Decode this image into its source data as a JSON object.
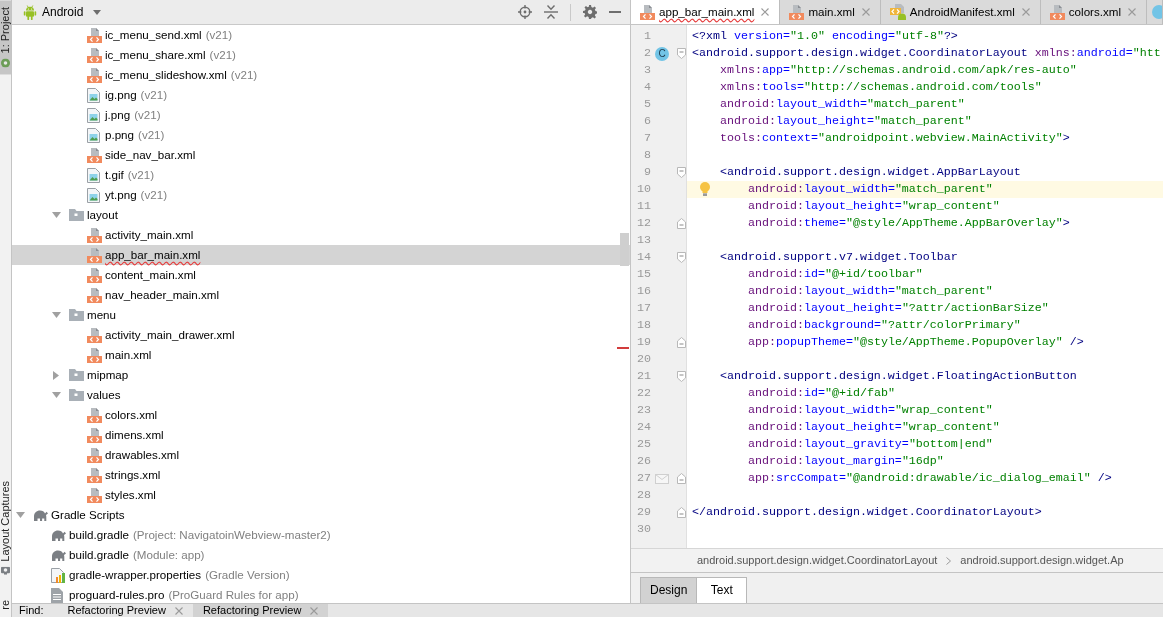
{
  "left_tabs": {
    "top": [
      {
        "label": "1: Project",
        "selected": true
      }
    ],
    "bottom": [
      {
        "label": "Layout Captures",
        "selected": false
      },
      {
        "label": "re",
        "selected": false
      }
    ]
  },
  "project": {
    "view": "Android",
    "tree": [
      {
        "children": [
          {
            "children": [
              {
                "children": [
                  {
                    "label": "ic_menu_send.xml",
                    "qualifier": "(v21)",
                    "kind": "xml",
                    "selected": false,
                    "error": false
                  },
                  {
                    "label": "ic_menu_share.xml",
                    "qualifier": "(v21)",
                    "kind": "xml",
                    "selected": false,
                    "error": false
                  },
                  {
                    "label": "ic_menu_slideshow.xml",
                    "qualifier": "(v21)",
                    "kind": "xml",
                    "selected": false,
                    "error": false
                  },
                  {
                    "label": "ig.png",
                    "qualifier": "(v21)",
                    "kind": "image",
                    "selected": false,
                    "error": false
                  },
                  {
                    "label": "j.png",
                    "qualifier": "(v21)",
                    "kind": "image",
                    "selected": false,
                    "error": false
                  },
                  {
                    "label": "p.png",
                    "qualifier": "(v21)",
                    "kind": "image",
                    "selected": false,
                    "error": false
                  },
                  {
                    "label": "side_nav_bar.xml",
                    "kind": "xml",
                    "selected": false,
                    "error": false
                  },
                  {
                    "label": "t.gif",
                    "qualifier": "(v21)",
                    "kind": "image",
                    "selected": false,
                    "error": false
                  },
                  {
                    "label": "yt.png",
                    "qualifier": "(v21)",
                    "kind": "image",
                    "selected": false,
                    "error": false
                  }
                ]
              },
              {
                "label": "layout",
                "kind": "folder",
                "expanded": true,
                "selected": false,
                "error": false,
                "children": [
                  {
                    "label": "activity_main.xml",
                    "kind": "xml",
                    "selected": false,
                    "error": false
                  },
                  {
                    "label": "app_bar_main.xml",
                    "kind": "xml",
                    "selected": true,
                    "error": true
                  },
                  {
                    "label": "content_main.xml",
                    "kind": "xml",
                    "selected": false,
                    "error": false
                  },
                  {
                    "label": "nav_header_main.xml",
                    "kind": "xml",
                    "selected": false,
                    "error": false
                  }
                ]
              },
              {
                "label": "menu",
                "kind": "folder",
                "expanded": true,
                "selected": false,
                "error": false,
                "children": [
                  {
                    "label": "activity_main_drawer.xml",
                    "kind": "xml",
                    "selected": false,
                    "error": false
                  },
                  {
                    "label": "main.xml",
                    "kind": "xml",
                    "selected": false,
                    "error": false
                  }
                ]
              },
              {
                "label": "mipmap",
                "kind": "folder",
                "expanded": false,
                "selected": false,
                "error": false
              },
              {
                "label": "values",
                "kind": "folder",
                "expanded": true,
                "selected": false,
                "error": false,
                "children": [
                  {
                    "label": "colors.xml",
                    "kind": "xml",
                    "selected": false,
                    "error": false
                  },
                  {
                    "label": "dimens.xml",
                    "kind": "xml",
                    "selected": false,
                    "error": false
                  },
                  {
                    "label": "drawables.xml",
                    "kind": "xml",
                    "selected": false,
                    "error": false
                  },
                  {
                    "label": "strings.xml",
                    "kind": "xml",
                    "selected": false,
                    "error": false
                  },
                  {
                    "label": "styles.xml",
                    "kind": "xml",
                    "selected": false,
                    "error": false
                  }
                ]
              }
            ]
          }
        ]
      },
      {
        "label": "Gradle Scripts",
        "kind": "gradle",
        "expanded": true,
        "selected": false,
        "error": false,
        "children": [
          {
            "label": "build.gradle",
            "qualifier": "(Project: NavigatoinWebview-master2)",
            "kind": "gradle",
            "selected": false,
            "error": false
          },
          {
            "label": "build.gradle",
            "qualifier": "(Module: app)",
            "kind": "gradle",
            "selected": false,
            "error": false
          },
          {
            "label": "gradle-wrapper.properties",
            "qualifier": "(Gradle Version)",
            "kind": "properties",
            "selected": false,
            "error": false
          },
          {
            "label": "proguard-rules.pro",
            "qualifier": "(ProGuard Rules for app)",
            "kind": "text",
            "selected": false,
            "error": false
          }
        ]
      }
    ]
  },
  "editor": {
    "tabs": [
      {
        "label": "app_bar_main.xml",
        "kind": "xml",
        "selected": true,
        "error": true
      },
      {
        "label": "main.xml",
        "kind": "xml",
        "selected": false,
        "error": false
      },
      {
        "label": "AndroidManifest.xml",
        "kind": "manifest",
        "selected": false,
        "error": false
      },
      {
        "label": "colors.xml",
        "kind": "xml",
        "selected": false,
        "error": false
      },
      {
        "kind": "class",
        "selected": false
      }
    ],
    "lines": [
      {
        "number": "1",
        "text": "<?xml version=\"1.0\" encoding=\"utf-8\"?>",
        "kind": "plain",
        "current": false
      },
      {
        "number": "2",
        "text": "<android.support.design.widget.CoordinatorLayout xmlns:android=\"htt",
        "kind": "start",
        "gutter_icon": {
          "kind": "class",
          "letter": "C"
        },
        "current": false
      },
      {
        "number": "3",
        "text": "    xmlns:app=\"http://schemas.android.com/apk/res-auto\"",
        "kind": "plain",
        "current": false
      },
      {
        "number": "4",
        "text": "    xmlns:tools=\"http://schemas.android.com/tools\"",
        "kind": "plain",
        "current": false
      },
      {
        "number": "5",
        "text": "    android:layout_width=\"match_parent\"",
        "kind": "plain",
        "current": false
      },
      {
        "number": "6",
        "text": "    android:layout_height=\"match_parent\"",
        "kind": "plain",
        "current": false
      },
      {
        "number": "7",
        "text": "    tools:context=\"androidpoint.webview.MainActivity\">",
        "kind": "plain",
        "current": false
      },
      {
        "number": "8",
        "kind": "plain",
        "current": false
      },
      {
        "number": "9",
        "text": "    <android.support.design.widget.AppBarLayout",
        "kind": "start",
        "current": false
      },
      {
        "number": "10",
        "text": "        android:layout_width=\"match_parent\"",
        "kind": "plain",
        "gutter_icon": {
          "kind": "bulb"
        },
        "current": true
      },
      {
        "number": "11",
        "text": "        android:layout_height=\"wrap_content\"",
        "kind": "plain",
        "current": false
      },
      {
        "number": "12",
        "text": "        android:theme=\"@style/AppTheme.AppBarOverlay\">",
        "kind": "end",
        "current": false
      },
      {
        "number": "13",
        "kind": "plain",
        "current": false
      },
      {
        "number": "14",
        "text": "    <android.support.v7.widget.Toolbar",
        "kind": "start",
        "current": false
      },
      {
        "number": "15",
        "text": "        android:id=\"@+id/toolbar\"",
        "kind": "plain",
        "current": false
      },
      {
        "number": "16",
        "text": "        android:layout_width=\"match_parent\"",
        "kind": "plain",
        "current": false
      },
      {
        "number": "17",
        "text": "        android:layout_height=\"?attr/actionBarSize\"",
        "kind": "plain",
        "current": false
      },
      {
        "number": "18",
        "text": "        android:background=\"?attr/colorPrimary\"",
        "kind": "plain",
        "current": false
      },
      {
        "number": "19",
        "text": "        app:popupTheme=\"@style/AppTheme.PopupOverlay\" />",
        "kind": "end",
        "current": false
      },
      {
        "number": "20",
        "kind": "plain",
        "current": false
      },
      {
        "number": "21",
        "text": "    <android.support.design.widget.FloatingActionButton",
        "kind": "start",
        "current": false
      },
      {
        "number": "22",
        "text": "        android:id=\"@+id/fab\"",
        "kind": "plain",
        "current": false
      },
      {
        "number": "23",
        "text": "        android:layout_width=\"wrap_content\"",
        "kind": "plain",
        "current": false
      },
      {
        "number": "24",
        "text": "        android:layout_height=\"wrap_content\"",
        "kind": "plain",
        "current": false
      },
      {
        "number": "25",
        "text": "        android:layout_gravity=\"bottom|end\"",
        "kind": "plain",
        "current": false
      },
      {
        "number": "26",
        "text": "        android:layout_margin=\"16dp\"",
        "kind": "plain",
        "current": false
      },
      {
        "number": "27",
        "text": "        app:srcCompat=\"@android:drawable/ic_dialog_email\" />",
        "kind": "end",
        "gutter_icon": {
          "kind": "mail"
        },
        "current": false
      },
      {
        "number": "28",
        "kind": "plain",
        "current": false
      },
      {
        "number": "29",
        "text": "</android.support.design.widget.CoordinatorLayout>",
        "kind": "end",
        "current": false
      },
      {
        "number": "30",
        "kind": "plain",
        "current": false
      }
    ],
    "breadcrumbs": [
      "android.support.design.widget.CoordinatorLayout",
      "android.support.design.widget.Ap"
    ],
    "mode_tabs": [
      {
        "label": "Design",
        "selected": false
      },
      {
        "label": "Text",
        "selected": true
      }
    ]
  },
  "find_bar": {
    "label": "Find:",
    "tabs": [
      {
        "label": "Refactoring Preview",
        "selected": false
      },
      {
        "label": "Refactoring Preview",
        "selected": true
      }
    ]
  }
}
